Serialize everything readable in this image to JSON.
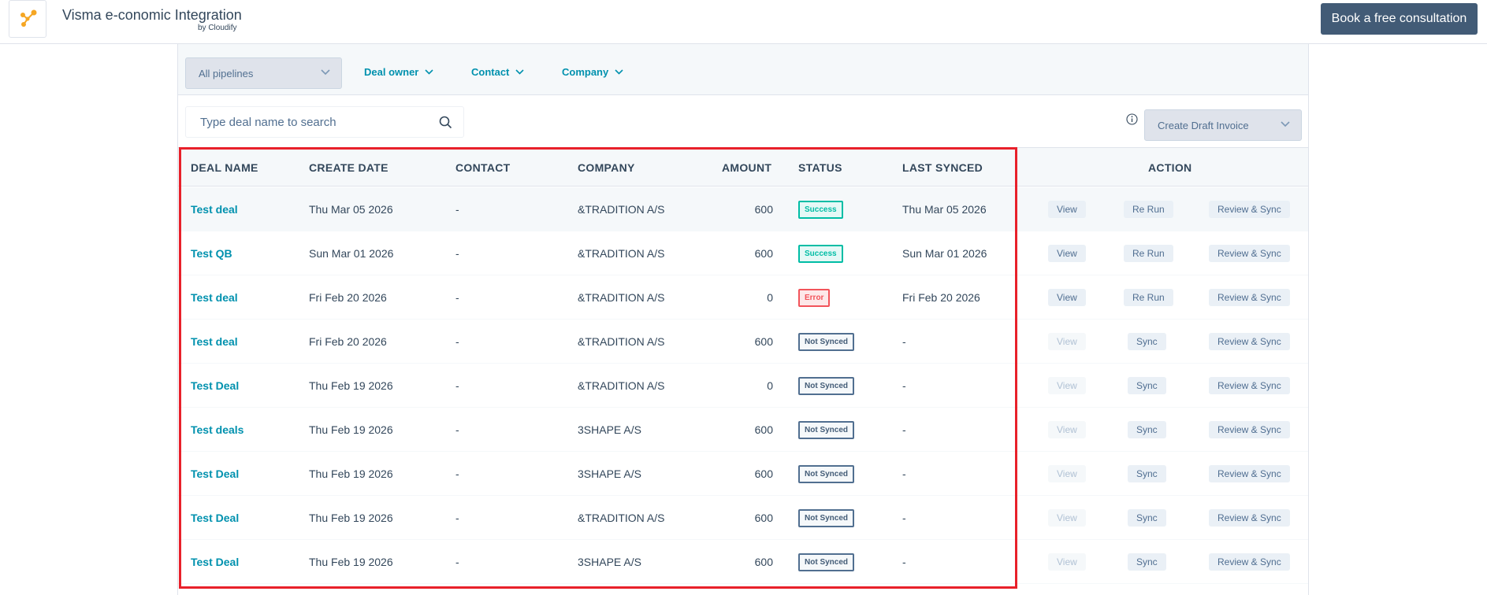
{
  "header": {
    "title": "Visma e-conomic Integration",
    "subtitle": "by Cloudify",
    "cta_label": "Book a free consultation",
    "logo_color": "#f5a623"
  },
  "filters": {
    "pipeline": "All pipelines",
    "deal_owner": "Deal owner",
    "contact": "Contact",
    "company": "Company"
  },
  "search": {
    "placeholder": "Type deal name to search"
  },
  "toolbar": {
    "draft_invoice": "Create Draft Invoice"
  },
  "table": {
    "columns": [
      "DEAL NAME",
      "CREATE DATE",
      "CONTACT",
      "COMPANY",
      "AMOUNT",
      "STATUS",
      "LAST SYNCED",
      "ACTION"
    ],
    "rows": [
      {
        "deal": "Test deal",
        "created": "Thu Mar 05 2026",
        "contact": "-",
        "company": "&TRADITION A/S",
        "amount": "600",
        "status": "Success",
        "status_kind": "success",
        "last_synced": "Thu Mar 05 2026",
        "actions": [
          "View",
          "Re Run",
          "Review & Sync"
        ],
        "view_enabled": true
      },
      {
        "deal": "Test QB",
        "created": "Sun Mar 01 2026",
        "contact": "-",
        "company": "&TRADITION A/S",
        "amount": "600",
        "status": "Success",
        "status_kind": "success",
        "last_synced": "Sun Mar 01 2026",
        "actions": [
          "View",
          "Re Run",
          "Review & Sync"
        ],
        "view_enabled": true
      },
      {
        "deal": "Test deal",
        "created": "Fri Feb 20 2026",
        "contact": "-",
        "company": "&TRADITION A/S",
        "amount": "0",
        "status": "Error",
        "status_kind": "error",
        "last_synced": "Fri Feb 20 2026",
        "actions": [
          "View",
          "Re Run",
          "Review & Sync"
        ],
        "view_enabled": true
      },
      {
        "deal": "Test deal",
        "created": "Fri Feb 20 2026",
        "contact": "-",
        "company": "&TRADITION A/S",
        "amount": "600",
        "status": "Not Synced",
        "status_kind": "notsynced",
        "last_synced": "-",
        "actions": [
          "View",
          "Sync",
          "Review & Sync"
        ],
        "view_enabled": false
      },
      {
        "deal": "Test Deal",
        "created": "Thu Feb 19 2026",
        "contact": "-",
        "company": "&TRADITION A/S",
        "amount": "0",
        "status": "Not Synced",
        "status_kind": "notsynced",
        "last_synced": "-",
        "actions": [
          "View",
          "Sync",
          "Review & Sync"
        ],
        "view_enabled": false
      },
      {
        "deal": "Test deals",
        "created": "Thu Feb 19 2026",
        "contact": "-",
        "company": "3SHAPE A/S",
        "amount": "600",
        "status": "Not Synced",
        "status_kind": "notsynced",
        "last_synced": "-",
        "actions": [
          "View",
          "Sync",
          "Review & Sync"
        ],
        "view_enabled": false
      },
      {
        "deal": "Test Deal",
        "created": "Thu Feb 19 2026",
        "contact": "-",
        "company": "3SHAPE A/S",
        "amount": "600",
        "status": "Not Synced",
        "status_kind": "notsynced",
        "last_synced": "-",
        "actions": [
          "View",
          "Sync",
          "Review & Sync"
        ],
        "view_enabled": false
      },
      {
        "deal": "Test Deal",
        "created": "Thu Feb 19 2026",
        "contact": "-",
        "company": "&TRADITION A/S",
        "amount": "600",
        "status": "Not Synced",
        "status_kind": "notsynced",
        "last_synced": "-",
        "actions": [
          "View",
          "Sync",
          "Review & Sync"
        ],
        "view_enabled": false
      },
      {
        "deal": "Test Deal",
        "created": "Thu Feb 19 2026",
        "contact": "-",
        "company": "3SHAPE A/S",
        "amount": "600",
        "status": "Not Synced",
        "status_kind": "notsynced",
        "last_synced": "-",
        "actions": [
          "View",
          "Sync",
          "Review & Sync"
        ],
        "view_enabled": false
      }
    ]
  },
  "colors": {
    "link": "#0091ae",
    "success": "#00bda5",
    "error": "#f2545b",
    "highlight": "#e8202a",
    "primary_button": "#425b76"
  }
}
